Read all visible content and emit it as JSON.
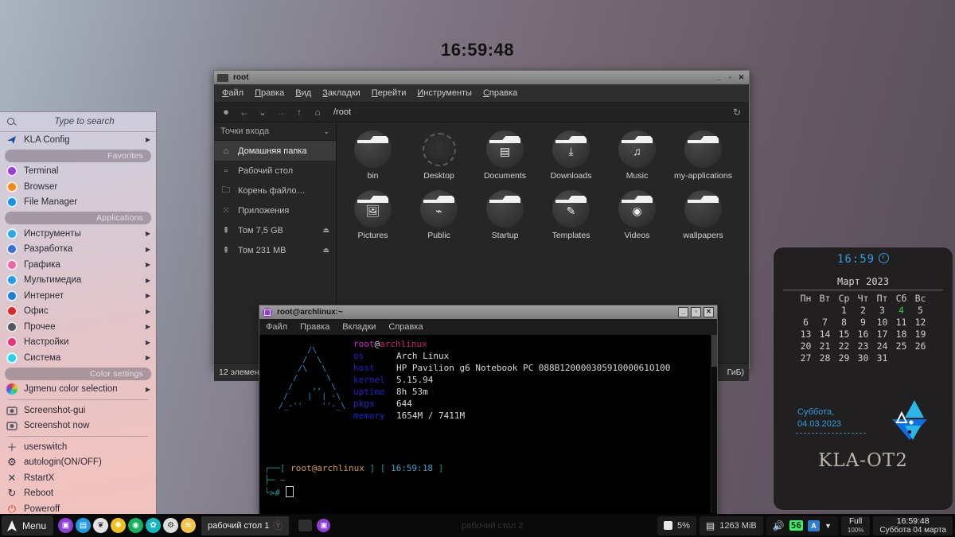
{
  "desktop": {
    "clock": "16:59:48"
  },
  "menu": {
    "search_placeholder": "Type to search",
    "config_item": "KLA Config",
    "favorites_header": "Favorites",
    "favorites": [
      {
        "label": "Terminal",
        "icon": "terminal-icon",
        "color": "#9a3fd6"
      },
      {
        "label": "Browser",
        "icon": "browser-icon",
        "color": "#f08a1e"
      },
      {
        "label": "File Manager",
        "icon": "file-manager-icon",
        "color": "#1e90e0"
      }
    ],
    "applications_header": "Applications",
    "applications": [
      {
        "label": "Инструменты",
        "icon": "tools-icon",
        "color": "#2aa8e8"
      },
      {
        "label": "Разработка",
        "icon": "development-icon",
        "color": "#3b6fd0"
      },
      {
        "label": "Графика",
        "icon": "graphics-icon",
        "color": "#e86aa0"
      },
      {
        "label": "Мультимедиа",
        "icon": "multimedia-icon",
        "color": "#2a9be8"
      },
      {
        "label": "Интернет",
        "icon": "internet-icon",
        "color": "#1e7fd0"
      },
      {
        "label": "Офис",
        "icon": "office-icon",
        "color": "#d82a2a"
      },
      {
        "label": "Прочее",
        "icon": "other-icon",
        "color": "#555560"
      },
      {
        "label": "Настройки",
        "icon": "settings-icon",
        "color": "#e8347a"
      },
      {
        "label": "Система",
        "icon": "system-icon",
        "color": "#2ad0e8"
      }
    ],
    "color_header": "Color settings",
    "color_item": {
      "label": "Jgmenu color selection",
      "icon": "color-wheel-icon"
    },
    "tools": [
      {
        "label": "Screenshot-gui",
        "icon": "camera-icon"
      },
      {
        "label": "Screenshot now",
        "icon": "camera-icon"
      }
    ],
    "session": [
      {
        "label": "userswitch",
        "icon": "plus-icon"
      },
      {
        "label": "autologin(ON/OFF)",
        "icon": "gear-icon"
      },
      {
        "label": "RstartX",
        "icon": "close-icon"
      },
      {
        "label": "Reboot",
        "icon": "reload-icon"
      },
      {
        "label": "Poweroff",
        "icon": "power-icon"
      }
    ]
  },
  "file_manager": {
    "title": "root",
    "window_buttons": {
      "minimize": "_",
      "maximize": "▫",
      "close": "✕"
    },
    "menubar": [
      "Файл",
      "Правка",
      "Вид",
      "Закладки",
      "Перейти",
      "Инструменты",
      "Справка"
    ],
    "path": "/root",
    "sidebar_header": "Точки входа",
    "sidebar": [
      {
        "label": "Домашняя папка",
        "icon": "home-icon",
        "selected": true,
        "eject": false
      },
      {
        "label": "Рабочий стол",
        "icon": "desktop-icon",
        "selected": false,
        "eject": false
      },
      {
        "label": "Корень файло…",
        "icon": "folder-icon",
        "selected": false,
        "eject": false
      },
      {
        "label": "Приложения",
        "icon": "apps-grid-icon",
        "selected": false,
        "eject": false
      },
      {
        "label": "Том 7,5 GB",
        "icon": "usb-icon",
        "selected": false,
        "eject": true
      },
      {
        "label": "Том 231 MB",
        "icon": "usb-icon",
        "selected": false,
        "eject": true
      }
    ],
    "files": [
      {
        "name": "bin",
        "icon": "folder-icon",
        "emblem": ""
      },
      {
        "name": "Desktop",
        "icon": "desktop-folder-icon",
        "emblem": ""
      },
      {
        "name": "Documents",
        "icon": "documents-folder-icon",
        "emblem": "▤"
      },
      {
        "name": "Downloads",
        "icon": "downloads-folder-icon",
        "emblem": "⤓"
      },
      {
        "name": "Music",
        "icon": "music-folder-icon",
        "emblem": "♫"
      },
      {
        "name": "my-applications",
        "icon": "folder-icon",
        "emblem": ""
      },
      {
        "name": "Pictures",
        "icon": "pictures-folder-icon",
        "emblem": "🖼"
      },
      {
        "name": "Public",
        "icon": "public-folder-icon",
        "emblem": "⌁"
      },
      {
        "name": "Startup",
        "icon": "folder-icon",
        "emblem": ""
      },
      {
        "name": "Templates",
        "icon": "templates-folder-icon",
        "emblem": "✎"
      },
      {
        "name": "Videos",
        "icon": "videos-folder-icon",
        "emblem": "◉"
      },
      {
        "name": "wallpapers",
        "icon": "folder-icon",
        "emblem": ""
      }
    ],
    "status_left": "12 элемен",
    "status_right": "ГиБ)"
  },
  "terminal": {
    "title": "root@archlinux:~",
    "window_buttons": {
      "minimize": "_",
      "maximize": "▫",
      "close": "✕"
    },
    "menubar": [
      "Файл",
      "Правка",
      "Вкладки",
      "Справка"
    ],
    "ascii_art": "        /\\\n       /  \\\n      /\\   \\\n     /      \\\n    /    ,,  \\\n   /    |  | -\\\n  /_-''    ''-_\\",
    "neofetch_title": {
      "user": "root",
      "at": "@",
      "host": "archlinux"
    },
    "neofetch": [
      {
        "key": "os",
        "value": "Arch Linux"
      },
      {
        "key": "host",
        "value": "HP Pavilion g6 Notebook PC 088B12000030591000061O100"
      },
      {
        "key": "kernel",
        "value": "5.15.94"
      },
      {
        "key": "uptime",
        "value": "8h 53m"
      },
      {
        "key": "pkgs",
        "value": "644"
      },
      {
        "key": "memory",
        "value": "1654M / 7411M"
      }
    ],
    "prompt_user": "root@archlinux",
    "prompt_time": "16:59:18",
    "prompt_dir": "~",
    "prompt_sigil": "#"
  },
  "conky": {
    "time": "16:59",
    "month_year": "Март 2023",
    "weekdays": [
      "Пн",
      "Вт",
      "Ср",
      "Чт",
      "Пт",
      "Сб",
      "Вс"
    ],
    "weeks": [
      [
        "",
        "",
        "1",
        "2",
        "3",
        "4",
        "5"
      ],
      [
        "6",
        "7",
        "8",
        "9",
        "10",
        "11",
        "12"
      ],
      [
        "13",
        "14",
        "15",
        "16",
        "17",
        "18",
        "19"
      ],
      [
        "20",
        "21",
        "22",
        "23",
        "24",
        "25",
        "26"
      ],
      [
        "27",
        "28",
        "29",
        "30",
        "31",
        "",
        ""
      ]
    ],
    "today": "4",
    "weekday_label": "Суббота,",
    "date_label": "04.03.2023",
    "brand": "KLA-OT2",
    "accent": "#2f9fe0"
  },
  "taskbar": {
    "menu_label": "Menu",
    "launchers": [
      {
        "name": "terminal-launcher",
        "glyph": "▣",
        "color": "#8e3fd6"
      },
      {
        "name": "file-manager-launcher",
        "glyph": "▤",
        "color": "#1e9be0"
      },
      {
        "name": "cherrytree-launcher",
        "glyph": "❦",
        "color": "#e4e4e4"
      },
      {
        "name": "gimp-launcher",
        "glyph": "✺",
        "color": "#f0c020"
      },
      {
        "name": "screenshot-launcher",
        "glyph": "◉",
        "color": "#17b05f"
      },
      {
        "name": "settings-launcher",
        "glyph": "✿",
        "color": "#12b8bc"
      },
      {
        "name": "updates-launcher",
        "glyph": "⚙",
        "color": "#dedede"
      },
      {
        "name": "layers-launcher",
        "glyph": "≋",
        "color": "#f2c64a"
      }
    ],
    "task_label": "рабочий стол 1",
    "desktop2_label": "рабочий стол 2",
    "cpu": "5%",
    "memory": "1263 MiB",
    "volume": "56",
    "keyboard": "A",
    "battery_state": "Full",
    "battery_percent": "100%",
    "clock_time": "16:59:48",
    "clock_date": "Суббота 04 марта"
  }
}
